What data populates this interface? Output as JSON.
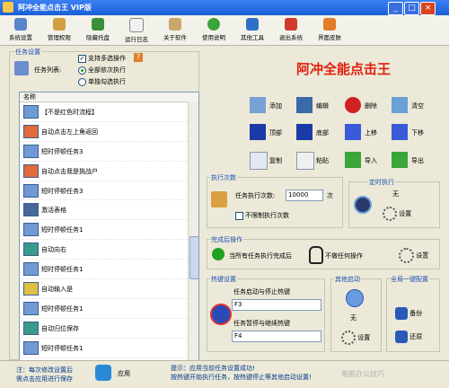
{
  "window": {
    "title": "阿冲全能点击王 VIP版",
    "minimize": "_",
    "maximize": "□",
    "close": "×"
  },
  "toolbar": [
    "系统设置",
    "管理权限",
    "隐藏托盘",
    "运行日志",
    "关于软件",
    "使用说明",
    "其他工具",
    "退出系统",
    "界面皮肤"
  ],
  "task_settings": {
    "group_label": "任务设置",
    "task_list_label": "任务列表:",
    "multi_select_label": "支持多选操作",
    "multi_select_checked": true,
    "help_badge": "?",
    "radio_all": "全部依次执行",
    "radio_single": "单独勾选执行",
    "radio_selected": "all"
  },
  "app_name": "阿冲全能点击王",
  "list": {
    "header": "名称",
    "items": [
      "【不是红色时流程】",
      "自动点击左上角返回",
      "短时停顿任务3",
      "自动点击我是挑战户",
      "短时停顿任务3",
      "激活表格",
      "短时停顿任务1",
      "自动向右",
      "短时停顿任务1",
      "自动输入是",
      "短时停顿任务1",
      "自动归位保存",
      "短时停顿任务1"
    ]
  },
  "actions": [
    "添加",
    "编辑",
    "删除",
    "清空",
    "顶部",
    "底部",
    "上移",
    "下移",
    "复制",
    "粘贴",
    "导入",
    "导出"
  ],
  "exec_count": {
    "group_label": "执行次数",
    "task_count_label": "任务执行次数:",
    "task_count_value": "10000",
    "unit": "次",
    "unlimited_label": "不限制执行次数",
    "unlimited_checked": false
  },
  "timer": {
    "group_label": "定时执行",
    "status": "无",
    "settings_label": "设置"
  },
  "after_done": {
    "group_label": "完成后操作",
    "stop_label": "当所有任务执行完成后",
    "action_label": "不做任何操作",
    "settings_label": "设置"
  },
  "hotkeys": {
    "group_label": "热键设置",
    "start_stop_label": "任务启动与停止热键",
    "start_stop_value": "F3",
    "pause_label": "任务暂停与继续热键",
    "pause_value": "F4"
  },
  "other_start": {
    "group_label": "其他启动",
    "status": "无",
    "settings_label": "设置"
  },
  "global_config": {
    "group_label": "全局一键配置",
    "backup_label": "备份",
    "restore_label": "还原"
  },
  "status_bar": {
    "note_line1": "注：每次修改设置后",
    "note_line2": "需点击应用进行保存",
    "apply_label": "应用",
    "tip_line1": "提示：应用当前任务设置成功!",
    "tip_line2": "按热键开始执行任务，按热键停止等其他启动设置!",
    "watermark": "电脑办公技巧"
  },
  "colors": {
    "title_bar": "#2a6fe8",
    "app_name_red": "#e02010",
    "background": "#ece9d8",
    "group_label_blue": "#1a4fb4"
  }
}
